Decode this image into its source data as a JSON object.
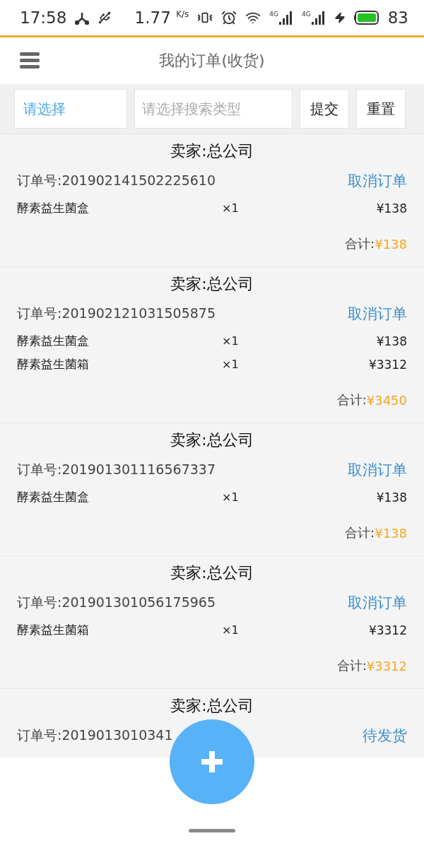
{
  "status_bar": {
    "time": "17:58",
    "speed": "1.77",
    "speed_unit": "K/s",
    "signal_labels": [
      "4G",
      "4G"
    ],
    "battery": "83"
  },
  "header": {
    "title": "我的订单(收货)"
  },
  "search": {
    "select": "请选择",
    "placeholder": "请选择搜索类型",
    "buttons": [
      "提交",
      "重置"
    ]
  },
  "orders": [
    {
      "seller": "卖家:总公司",
      "order_no": "订单号:201902141502225610",
      "action": "取消订单",
      "items": [
        {
          "name": "酵素益生菌盒",
          "qty": "×1",
          "price": "¥138"
        }
      ],
      "total_label": "合计:",
      "total": "¥138"
    },
    {
      "seller": "卖家:总公司",
      "order_no": "订单号:201902121031505875",
      "action": "取消订单",
      "items": [
        {
          "name": "酵素益生菌盒",
          "qty": "×1",
          "price": "¥138"
        },
        {
          "name": "酵素益生菌箱",
          "qty": "×1",
          "price": "¥3312"
        }
      ],
      "total_label": "合计:",
      "total": "¥3450"
    },
    {
      "seller": "卖家:总公司",
      "order_no": "订单号:201901301116567337",
      "action": "取消订单",
      "items": [
        {
          "name": "酵素益生菌盒",
          "qty": "×1",
          "price": "¥138"
        }
      ],
      "total_label": "合计:",
      "total": "¥138"
    },
    {
      "seller": "卖家:总公司",
      "order_no": "订单号:201901301056175965",
      "action": "取消订单",
      "items": [
        {
          "name": "酵素益生菌箱",
          "qty": "×1",
          "price": "¥3312"
        }
      ],
      "total_label": "合计:",
      "total": "¥3312"
    },
    {
      "seller": "卖家:总公司",
      "order_no": "订单号:2019013010341",
      "action": "待发货"
    }
  ]
}
